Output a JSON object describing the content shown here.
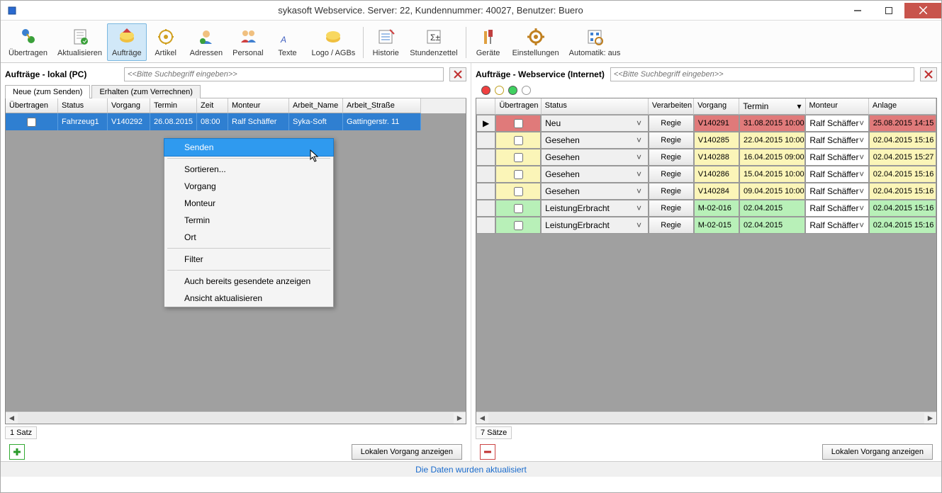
{
  "window": {
    "title": "sykasoft Webservice. Server: 22, Kundennummer: 40027, Benutzer: Buero"
  },
  "toolbar": {
    "items": [
      {
        "label": "Übertragen"
      },
      {
        "label": "Aktualisieren"
      },
      {
        "label": "Aufträge",
        "active": true
      },
      {
        "label": "Artikel"
      },
      {
        "label": "Adressen"
      },
      {
        "label": "Personal"
      },
      {
        "label": "Texte"
      },
      {
        "label": "Logo / AGBs"
      }
    ],
    "items2": [
      {
        "label": "Historie"
      },
      {
        "label": "Stundenzettel"
      }
    ],
    "items3": [
      {
        "label": "Geräte"
      },
      {
        "label": "Einstellungen"
      },
      {
        "label": "Automatik: aus"
      }
    ]
  },
  "left": {
    "title": "Aufträge - lokal (PC)",
    "search_placeholder": "<<Bitte Suchbegriff eingeben>>",
    "tabs": [
      "Neue (zum Senden)",
      "Erhalten (zum Verrechnen)"
    ],
    "headers": [
      "Übertragen",
      "Status",
      "Vorgang",
      "Termin",
      "Zeit",
      "Monteur",
      "Arbeit_Name",
      "Arbeit_Straße"
    ],
    "row": {
      "status": "Fahrzeug1",
      "vorgang": "V140292",
      "termin": "26.08.2015",
      "zeit": "08:00",
      "monteur": "Ralf Schäffer",
      "arbeit_name": "Syka-Soft",
      "arbeit_str": "Gattingerstr. 11"
    },
    "count": "1 Satz",
    "button": "Lokalen Vorgang anzeigen"
  },
  "right": {
    "title": "Aufträge - Webservice (Internet)",
    "search_placeholder": "<<Bitte Suchbegriff eingeben>>",
    "headers": [
      "Übertragen",
      "Status",
      "Verarbeiten",
      "Vorgang",
      "Termin",
      "Monteur",
      "Anlage"
    ],
    "rows": [
      {
        "color": "red",
        "status": "Neu",
        "verarbeiten": "Regie",
        "vorgang": "V140291",
        "termin": "31.08.2015 10:00",
        "monteur": "Ralf Schäffer",
        "anlage": "25.08.2015 14:15",
        "current": true
      },
      {
        "color": "yellow",
        "status": "Gesehen",
        "verarbeiten": "Regie",
        "vorgang": "V140285",
        "termin": "22.04.2015 10:00",
        "monteur": "Ralf Schäffer",
        "anlage": "02.04.2015 15:16"
      },
      {
        "color": "yellow",
        "status": "Gesehen",
        "verarbeiten": "Regie",
        "vorgang": "V140288",
        "termin": "16.04.2015 09:00",
        "monteur": "Ralf Schäffer",
        "anlage": "02.04.2015 15:27"
      },
      {
        "color": "yellow",
        "status": "Gesehen",
        "verarbeiten": "Regie",
        "vorgang": "V140286",
        "termin": "15.04.2015 10:00",
        "monteur": "Ralf Schäffer",
        "anlage": "02.04.2015 15:16"
      },
      {
        "color": "yellow",
        "status": "Gesehen",
        "verarbeiten": "Regie",
        "vorgang": "V140284",
        "termin": "09.04.2015 10:00",
        "monteur": "Ralf Schäffer",
        "anlage": "02.04.2015 15:16"
      },
      {
        "color": "green",
        "status": "LeistungErbracht",
        "verarbeiten": "Regie",
        "vorgang": "M-02-016",
        "termin": "02.04.2015",
        "monteur": "Ralf Schäffer",
        "anlage": "02.04.2015 15:16"
      },
      {
        "color": "green",
        "status": "LeistungErbracht",
        "verarbeiten": "Regie",
        "vorgang": "M-02-015",
        "termin": "02.04.2015",
        "monteur": "Ralf Schäffer",
        "anlage": "02.04.2015 15:16"
      }
    ],
    "count": "7 Sätze",
    "button": "Lokalen Vorgang anzeigen"
  },
  "context_menu": {
    "items": [
      {
        "label": "Senden",
        "hl": true
      },
      {
        "sep": true
      },
      {
        "label": "Sortieren..."
      },
      {
        "label": "Vorgang"
      },
      {
        "label": "Monteur"
      },
      {
        "label": "Termin"
      },
      {
        "label": "Ort"
      },
      {
        "sep": true
      },
      {
        "label": "Filter"
      },
      {
        "sep": true
      },
      {
        "label": "Auch bereits gesendete anzeigen"
      },
      {
        "label": "Ansicht aktualisieren"
      }
    ]
  },
  "statusbar": "Die Daten wurden aktualisiert"
}
